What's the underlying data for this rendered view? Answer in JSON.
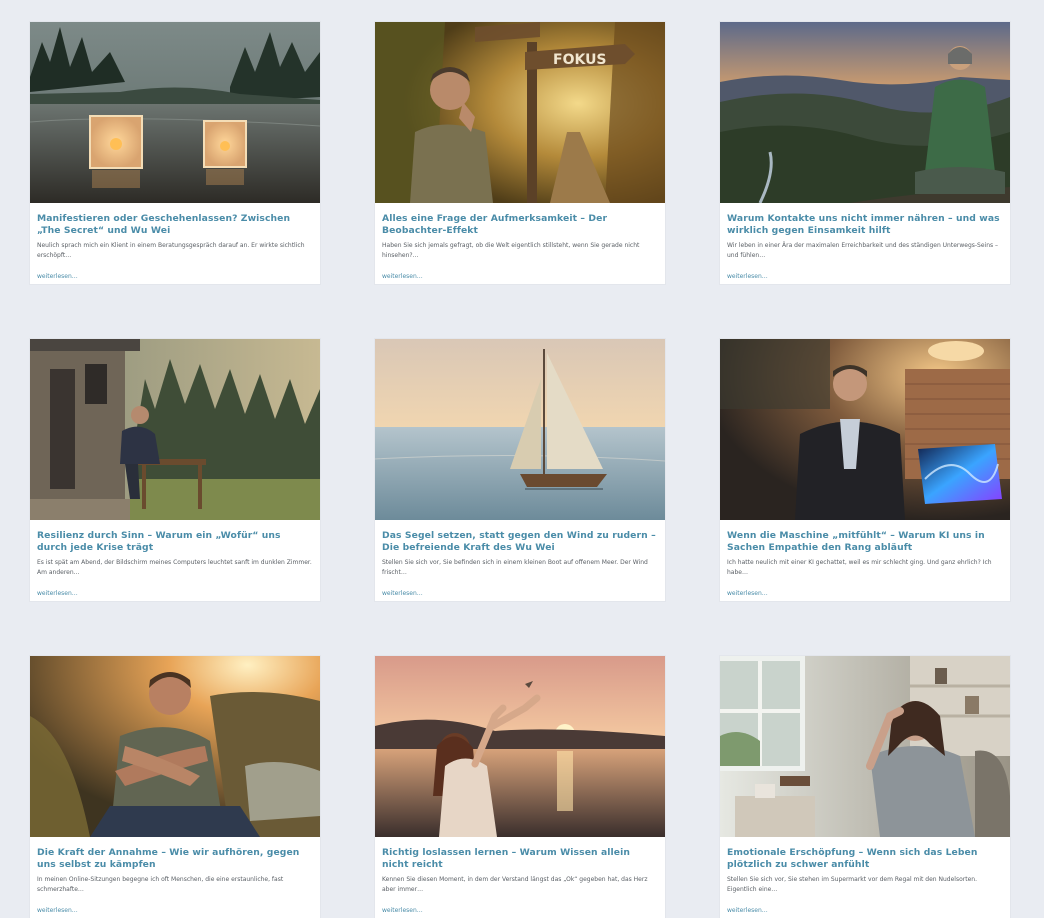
{
  "posts": [
    {
      "title": "Manifestieren oder Geschehenlassen? Zwischen „The Secret“ und Wu Wei",
      "excerpt": "Neulich sprach mich ein Klient in einem Beratungsgespräch darauf an. Er wirkte sichtlich erschöpft…",
      "more": "weiterlesen…",
      "image": "lake-lanterns-image"
    },
    {
      "title": "Alles eine Frage der Aufmerksamkeit – Der Beobachter-Effekt",
      "excerpt": "Haben Sie sich jemals gefragt, ob die Welt eigentlich stillsteht, wenn Sie gerade nicht hinsehen?…",
      "more": "weiterlesen…",
      "image": "forest-signpost-image",
      "sign_text": "FOKUS"
    },
    {
      "title": "Warum Kontakte uns nicht immer nähren – und was wirklich gegen Einsamkeit hilft",
      "excerpt": "Wir leben in einer Ära der maximalen Erreichbarkeit und des ständigen Unterwegs-Seins – und fühlen…",
      "more": "weiterlesen…",
      "image": "mountain-meditation-image"
    },
    {
      "title": "Resilienz durch Sinn – Warum ein „Wofür“ uns durch jede Krise trägt",
      "excerpt": "Es ist spät am Abend, der Bildschirm meines Computers leuchtet sanft im dunklen Zimmer. Am anderen…",
      "more": "weiterlesen…",
      "image": "cabin-writing-image"
    },
    {
      "title": "Das Segel setzen, statt gegen den Wind zu rudern – Die befreiende Kraft des Wu Wei",
      "excerpt": "Stellen Sie sich vor, Sie befinden sich in einem kleinen Boot auf offenem Meer. Der Wind frischt…",
      "more": "weiterlesen…",
      "image": "sailboat-image"
    },
    {
      "title": "Wenn die Maschine „mitfühlt“ – Warum KI uns in Sachen Empathie den Rang abläuft",
      "excerpt": "Ich hatte neulich mit einer KI gechattet, weil es mir schlecht ging. Und ganz ehrlich? Ich habe…",
      "more": "weiterlesen…",
      "image": "laptop-man-image"
    },
    {
      "title": "Die Kraft der Annahme – Wie wir aufhören, gegen uns selbst zu kämpfen",
      "excerpt": "In meinen Online-Sitzungen begegne ich oft Menschen, die eine erstaunliche, fast schmerzhafte…",
      "more": "weiterlesen…",
      "image": "self-hug-image"
    },
    {
      "title": "Richtig loslassen lernen – Warum Wissen allein nicht reicht",
      "excerpt": "Kennen Sie diesen Moment, in dem der Verstand längst das „Ok“ gegeben hat, das Herz aber immer…",
      "more": "weiterlesen…",
      "image": "letting-go-image"
    },
    {
      "title": "Emotionale Erschöpfung – Wenn sich das Leben plötzlich zu schwer anfühlt",
      "excerpt": "Stellen Sie sich vor, Sie stehen im Supermarkt vor dem Regal mit den Nudelsorten. Eigentlich eine…",
      "more": "weiterlesen…",
      "image": "exhausted-woman-image"
    }
  ]
}
